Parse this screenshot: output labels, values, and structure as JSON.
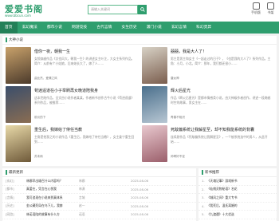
{
  "site": {
    "logo": "爱爱书阁",
    "domain": "www.bbcun.com"
  },
  "search": {
    "placeholder": "请输入关键词"
  },
  "header_links": [
    {
      "label": "手机版"
    },
    {
      "label": "书架"
    }
  ],
  "nav": [
    {
      "label": "首页",
      "active": true
    },
    {
      "label": "玄幻魔法"
    },
    {
      "label": "都市小说"
    },
    {
      "label": "网游竞技"
    },
    {
      "label": "古代言情"
    },
    {
      "label": "女生历史"
    },
    {
      "label": "潇门小说"
    },
    {
      "label": "玄幻言情"
    },
    {
      "label": "科幻灵异"
    }
  ],
  "featured": {
    "heading": "大神小说",
    "books": [
      {
        "title": "借你一夜，朝我一生",
        "desc": "女频穿越作品《文也风大，朝我一生》的讲述女主叶芷，大女主系列作品。简介：从前有个小姑娘，后来她长大了，嫁了人……",
        "author": "曲比杰，爱情之风",
        "cover_a": "#c9a26b",
        "cover_b": "#4b3a2b"
      },
      {
        "title": "囍囍，我是大人了！",
        "desc": "男主是男主和女主《一起走过的日子》，《也是我的大人了》系列作品。主角：小月，小北。简介：那年，我们都还很小……",
        "author": "唐女神",
        "cover_a": "#d8d2c6",
        "cover_b": "#7a5d4d"
      },
      {
        "title": "苟逍遥道在小子举刷再女晚道陪我身",
        "desc": "这本完结作品，全文由小说作者某某，作者新书创作古今小说《苟逍遥道》系列作品，被推荐……",
        "author": "前仪的下",
        "cover_a": "#3b4e6b",
        "cover_b": "#8a6d52"
      },
      {
        "title": "辉火后星光",
        "desc": "作品《辉火后星光》是都市情感类小说，由大神级作者创作，讲述一段跨越时空的故事，男女主在……",
        "author": "青春不相识",
        "cover_a": "#4a6f8c",
        "cover_b": "#b8c7d3"
      },
      {
        "title": "重生后，我嫁给了侍任当教",
        "desc": "主角是他我之的小说作品《重生后，我嫁给了侍任当教》，女主姜宁重生回到……",
        "author": "苏未雨",
        "cover_a": "#e8d9a8",
        "cover_b": "#6f5a3a"
      },
      {
        "title": "死敌偏系统让我解星至，却不知我能系统的背囊",
        "desc": "连续剧作品《死敌偏系统让我解星至》，一个被系统选中的男人，从此开始……",
        "author": "帅哥好不定",
        "cover_a": "#e9c9cf",
        "cover_b": "#9b5f6b"
      }
    ]
  },
  "updates": {
    "heading": "最新更新",
    "rows": [
      {
        "category": "[玄幻]",
        "title": "林娜早出雄召什么内容吗？",
        "author": "林娜",
        "date": "2025-08-06"
      },
      {
        "category": "[都市]",
        "title": "真爱在，凭言在心悦我",
        "author": "林潇",
        "date": "2025-08-06"
      },
      {
        "category": "[言情]",
        "title": "我可追现在小说来到真体系",
        "author": "言城",
        "date": "2025-08-06"
      },
      {
        "category": "[历史]",
        "title": "金公藏死局在乌下儿，我赫",
        "author": "赵一",
        "date": "2025-08-06"
      },
      {
        "category": "[网游]",
        "title": "林诺语陪的故事有什么方",
        "author": "诺语",
        "date": "2025-08-06"
      }
    ]
  },
  "ranking": {
    "heading": "新书推荐",
    "items": [
      {
        "num": "1.",
        "title": "《天魂记事》游戏新书"
      },
      {
        "num": "2.",
        "title": "《仙桃灵物秘语》名花"
      },
      {
        "num": "3.",
        "title": "《城风之间》重大专书"
      },
      {
        "num": "4.",
        "title": "《我死后，温氏离婚的"
      },
      {
        "num": "5.",
        "title": "《九渡遇》十大优选"
      }
    ]
  }
}
